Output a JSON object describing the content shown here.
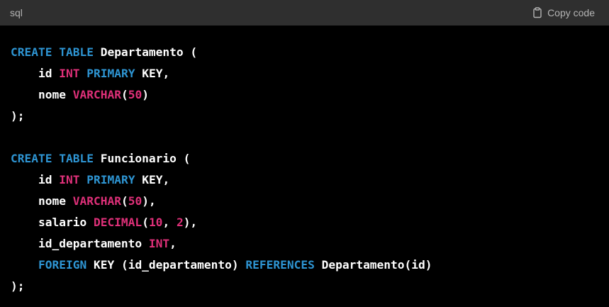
{
  "header": {
    "language": "sql",
    "copy_label": "Copy code"
  },
  "code": {
    "lines": [
      [
        {
          "t": "CREATE TABLE",
          "c": "kw"
        },
        {
          "t": " Departamento (",
          "c": "plain"
        }
      ],
      [
        {
          "t": "    id ",
          "c": "plain"
        },
        {
          "t": "INT",
          "c": "type"
        },
        {
          "t": " ",
          "c": "plain"
        },
        {
          "t": "PRIMARY",
          "c": "kw"
        },
        {
          "t": " KEY,",
          "c": "plain"
        }
      ],
      [
        {
          "t": "    nome ",
          "c": "plain"
        },
        {
          "t": "VARCHAR",
          "c": "type"
        },
        {
          "t": "(",
          "c": "plain"
        },
        {
          "t": "50",
          "c": "num"
        },
        {
          "t": ")",
          "c": "plain"
        }
      ],
      [
        {
          "t": ");",
          "c": "plain"
        }
      ],
      [],
      [
        {
          "t": "CREATE TABLE",
          "c": "kw"
        },
        {
          "t": " Funcionario (",
          "c": "plain"
        }
      ],
      [
        {
          "t": "    id ",
          "c": "plain"
        },
        {
          "t": "INT",
          "c": "type"
        },
        {
          "t": " ",
          "c": "plain"
        },
        {
          "t": "PRIMARY",
          "c": "kw"
        },
        {
          "t": " KEY,",
          "c": "plain"
        }
      ],
      [
        {
          "t": "    nome ",
          "c": "plain"
        },
        {
          "t": "VARCHAR",
          "c": "type"
        },
        {
          "t": "(",
          "c": "plain"
        },
        {
          "t": "50",
          "c": "num"
        },
        {
          "t": "),",
          "c": "plain"
        }
      ],
      [
        {
          "t": "    salario ",
          "c": "plain"
        },
        {
          "t": "DECIMAL",
          "c": "type"
        },
        {
          "t": "(",
          "c": "plain"
        },
        {
          "t": "10",
          "c": "num"
        },
        {
          "t": ", ",
          "c": "plain"
        },
        {
          "t": "2",
          "c": "num"
        },
        {
          "t": "),",
          "c": "plain"
        }
      ],
      [
        {
          "t": "    id_departamento ",
          "c": "plain"
        },
        {
          "t": "INT",
          "c": "type"
        },
        {
          "t": ",",
          "c": "plain"
        }
      ],
      [
        {
          "t": "    ",
          "c": "plain"
        },
        {
          "t": "FOREIGN",
          "c": "kw"
        },
        {
          "t": " KEY (id_departamento) ",
          "c": "plain"
        },
        {
          "t": "REFERENCES",
          "c": "kw"
        },
        {
          "t": " Departamento(id)",
          "c": "plain"
        }
      ],
      [
        {
          "t": ");",
          "c": "plain"
        }
      ]
    ]
  },
  "icons": {
    "copy": "clipboard-icon"
  },
  "colors": {
    "header_bg": "#2f2f2f",
    "body_bg": "#000000",
    "keyword": "#2e95d3",
    "type": "#df3079",
    "number": "#df3079",
    "plain": "#ffffff",
    "header_text": "#b4b4b4"
  }
}
